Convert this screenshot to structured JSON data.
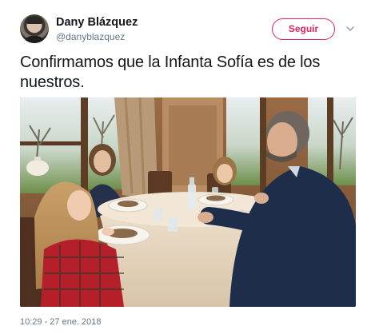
{
  "user": {
    "display_name": "Dany Blázquez",
    "handle": "@danyblazquez"
  },
  "actions": {
    "follow_label": "Seguir",
    "more_icon": "chevron-down-icon"
  },
  "tweet": {
    "text": "Confirmamos que la Infanta Sofía es de los nuestros.",
    "timestamp": "10:29 - 27 ene. 2018"
  },
  "colors": {
    "accent": "#e0245e",
    "text": "#14171a",
    "secondary": "#657786"
  }
}
